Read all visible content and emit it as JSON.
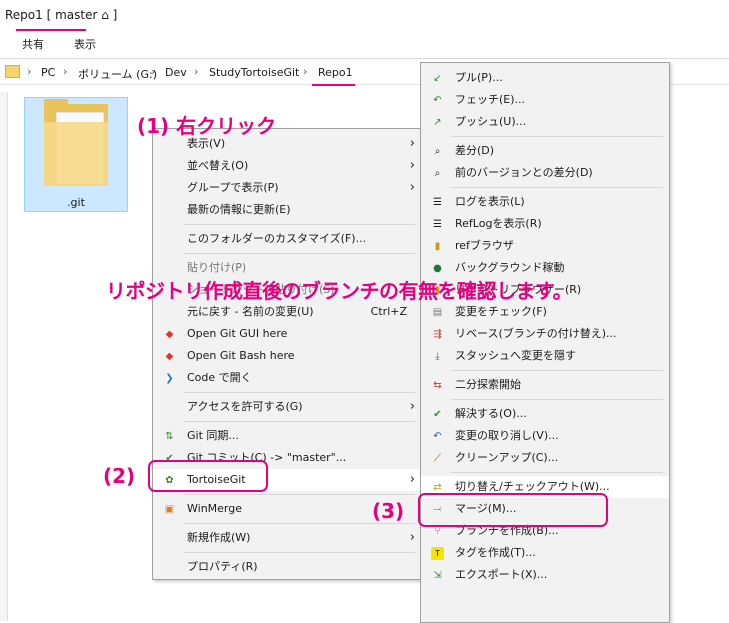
{
  "window": {
    "title": "Repo1 [ master ⌂ ]"
  },
  "ribbon": {
    "tabs": [
      "共有",
      "表示"
    ]
  },
  "address": {
    "crumbs": [
      "PC",
      "ボリューム (G:)",
      "Dev",
      "StudyTortoiseGit",
      "Repo1"
    ],
    "separator": "›"
  },
  "folder": {
    "name": ".git"
  },
  "context_menu": {
    "items": [
      {
        "label": "表示(V)",
        "submenu": true
      },
      {
        "label": "並べ替え(O)",
        "submenu": true
      },
      {
        "label": "グループで表示(P)",
        "submenu": true
      },
      {
        "label": "最新の情報に更新(E)"
      },
      {
        "label": "このフォルダーのカスタマイズ(F)..."
      },
      {
        "label": "貼り付け(P)"
      },
      {
        "label": "ショートカットの貼り付け(S)"
      },
      {
        "label": "元に戻す - 名前の変更(U)",
        "shortcut": "Ctrl+Z"
      },
      {
        "label": "Open Git GUI here"
      },
      {
        "label": "Open Git Bash here"
      },
      {
        "label": "Code で開く"
      },
      {
        "label": "アクセスを許可する(G)",
        "submenu": true
      },
      {
        "label": "Git 同期..."
      },
      {
        "label": "Git コミット(C) -> \"master\"..."
      },
      {
        "label": "TortoiseGit",
        "submenu": true
      },
      {
        "label": "WinMerge"
      },
      {
        "label": "新規作成(W)",
        "submenu": true
      },
      {
        "label": "プロパティ(R)"
      }
    ]
  },
  "tortoise_menu": {
    "items": [
      {
        "label": "プル(P)..."
      },
      {
        "label": "フェッチ(E)..."
      },
      {
        "label": "プッシュ(U)..."
      },
      {
        "label": "差分(D)"
      },
      {
        "label": "前のバージョンとの差分(D)"
      },
      {
        "label": "ログを表示(L)"
      },
      {
        "label": "RefLogを表示(R)"
      },
      {
        "label": "refブラウザ"
      },
      {
        "label": "バックグラウンド稼動"
      },
      {
        "label": "リポジトリブラウザー(R)"
      },
      {
        "label": "変更をチェック(F)"
      },
      {
        "label": "リベース(ブランチの付け替え)..."
      },
      {
        "label": "スタッシュへ変更を隠す"
      },
      {
        "label": "二分探索開始"
      },
      {
        "label": "解決する(O)..."
      },
      {
        "label": "変更の取り消し(V)..."
      },
      {
        "label": "クリーンアップ(C)..."
      },
      {
        "label": "切り替え/チェックアウト(W)..."
      },
      {
        "label": "マージ(M)..."
      },
      {
        "label": "ブランチを作成(B)..."
      },
      {
        "label": "タグを作成(T)..."
      },
      {
        "label": "エクスポート(X)..."
      }
    ]
  },
  "annotations": {
    "step1": "(1) 右クリック",
    "step2": "(2)",
    "step3": "(3)",
    "caption": "リポジトリ作成直後のブランチの有無を確認します。"
  },
  "colors": {
    "accent": "#e4007f",
    "selection": "#cce8ff",
    "menu_bg": "#f2f2f2"
  }
}
